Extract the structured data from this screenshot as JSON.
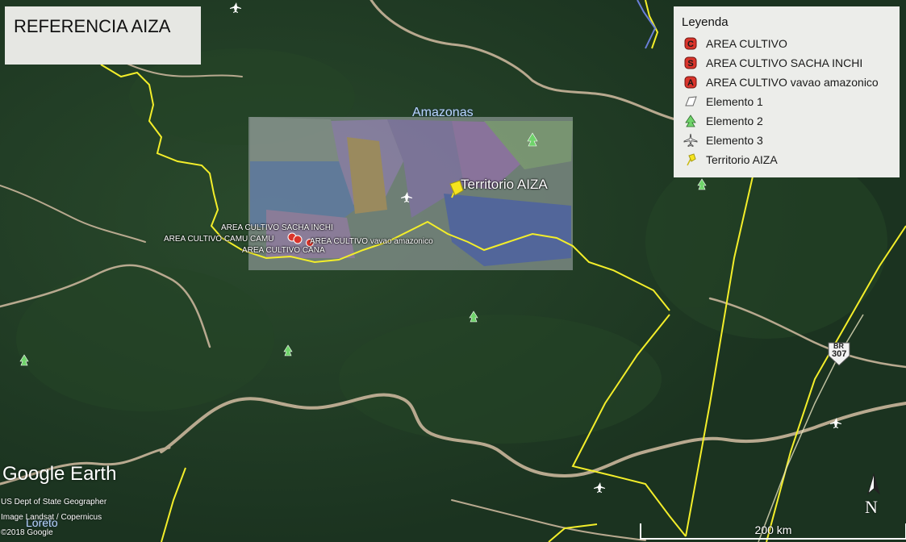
{
  "title": "REFERENCIA AIZA",
  "legend": {
    "title": "Leyenda",
    "items": [
      {
        "badge": "C",
        "label": "AREA CULTIVO",
        "icon": "red-c-marker-icon"
      },
      {
        "badge": "S",
        "label": "AREA CULTIVO SACHA INCHI",
        "icon": "red-s-marker-icon"
      },
      {
        "badge": "A",
        "label": "AREA CULTIVO vavao amazonico",
        "icon": "red-a-marker-icon"
      },
      {
        "badge": "",
        "label": "Elemento 1",
        "icon": "polygon-shape-icon"
      },
      {
        "badge": "",
        "label": "Elemento 2",
        "icon": "tree-icon"
      },
      {
        "badge": "",
        "label": "Elemento 3",
        "icon": "airport-icon"
      },
      {
        "badge": "",
        "label": "Territorio AIZA",
        "icon": "yellow-pushpin-icon"
      }
    ]
  },
  "map": {
    "region_label": "Amazonas",
    "territory_label": "Territorio AIZA",
    "placemarks": {
      "sacha_inchi": "AREA CULTIVO SACHA INCHI",
      "camu_camu": "AREA CULTIVO CAMU CAMU",
      "vavao": "AREA CULTIVO vavao amazonico",
      "cana": "AREA CULTIVO CANA"
    },
    "road_shield": "BR\n307",
    "road_number_top": "BR",
    "road_number_bottom": "307",
    "place_loreto": "Loreto"
  },
  "branding": {
    "logo": "Google Earth",
    "credit_1": "US Dept of State Geographer",
    "credit_2": "Image Landsat / Copernicus",
    "credit_3": "©2018 Google"
  },
  "scale_bar": {
    "label": "200 km"
  },
  "north_arrow": {
    "label": "N"
  },
  "colors": {
    "forest": "#1f3a22",
    "border_line": "#f3ee2a",
    "river": "#b8a98f",
    "marker_red": "#d9342b",
    "pin_yellow": "#f5e31e"
  }
}
